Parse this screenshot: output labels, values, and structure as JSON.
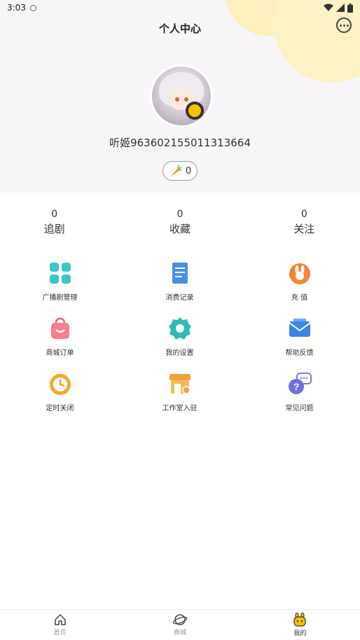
{
  "status_bar": {
    "time": "3:03"
  },
  "header": {
    "title": "个人中心"
  },
  "profile": {
    "username": "听姬963602155011313664",
    "carrots": "0"
  },
  "stats": [
    {
      "value": "0",
      "label": "追剧"
    },
    {
      "value": "0",
      "label": "收藏"
    },
    {
      "value": "0",
      "label": "关注"
    }
  ],
  "grid": [
    {
      "label": "广播剧管理",
      "icon": "grid-apps-icon"
    },
    {
      "label": "消费记录",
      "icon": "receipt-icon"
    },
    {
      "label": "充 值",
      "icon": "bunny-coin-icon"
    },
    {
      "label": "商城订单",
      "icon": "shopping-bag-icon"
    },
    {
      "label": "我的设置",
      "icon": "gear-icon"
    },
    {
      "label": "帮助反馈",
      "icon": "mail-icon"
    },
    {
      "label": "定时关闭",
      "icon": "alarm-clock-icon"
    },
    {
      "label": "工作室入驻",
      "icon": "storefront-icon"
    },
    {
      "label": "常见问题",
      "icon": "question-chat-icon"
    }
  ],
  "tabbar": [
    {
      "label": "首页",
      "icon": "home-icon"
    },
    {
      "label": "商城",
      "icon": "planet-icon"
    },
    {
      "label": "我的",
      "icon": "bunny-face-icon"
    }
  ],
  "colors": {
    "header_bg": "#f8f6f8",
    "accent_yellow": "#f3c300"
  }
}
